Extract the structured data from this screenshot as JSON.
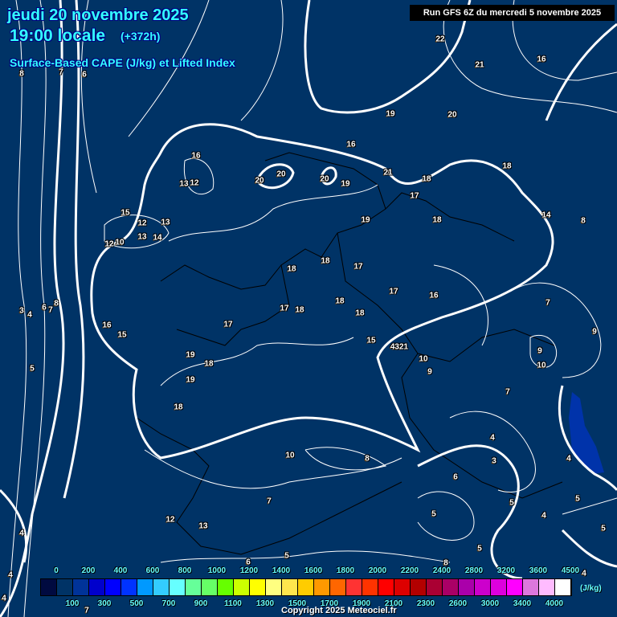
{
  "header": {
    "date": "jeudi 20 novembre 2025",
    "time": "19:00 locale",
    "lead": "(+372h)",
    "parameter": "Surface-Based CAPE (J/kg) et Lifted Index",
    "run": "Run GFS 6Z du mercredi 5 novembre 2025"
  },
  "legend": {
    "unit": "(J/kg)",
    "labels": [
      "0",
      "100",
      "200",
      "300",
      "400",
      "500",
      "600",
      "700",
      "800",
      "900",
      "1000",
      "1100",
      "1200",
      "1300",
      "1400",
      "1500",
      "1600",
      "1700",
      "1800",
      "1900",
      "2000",
      "2100",
      "2200",
      "2300",
      "2400",
      "2600",
      "2800",
      "3000",
      "3200",
      "3400",
      "3600",
      "4000",
      "4500"
    ],
    "colors": [
      "#000a40",
      "#003366",
      "#003399",
      "#0000cc",
      "#0000ff",
      "#0033ff",
      "#0099ff",
      "#33ccff",
      "#66ffff",
      "#66ff99",
      "#66ff66",
      "#66ff00",
      "#ccff00",
      "#ffff00",
      "#ffff80",
      "#ffe64d",
      "#ffcc00",
      "#ff9900",
      "#ff6600",
      "#ff3333",
      "#ff3300",
      "#ff0000",
      "#dd0000",
      "#b30000",
      "#aa0033",
      "#aa0066",
      "#aa00aa",
      "#cc00cc",
      "#dd00dd",
      "#ff00ff",
      "#dd77dd",
      "#ffbbff",
      "#ffffff"
    ]
  },
  "lifted_index_labels": [
    "8",
    "7",
    "6",
    "22",
    "21",
    "16",
    "19",
    "20",
    "16",
    "16",
    "18",
    "21",
    "18",
    "13",
    "12",
    "20",
    "20",
    "20",
    "19",
    "17",
    "15",
    "12",
    "13",
    "14",
    "8",
    "19",
    "18",
    "12",
    "10",
    "13",
    "14",
    "18",
    "18",
    "17",
    "17",
    "16",
    "17",
    "18",
    "18",
    "18",
    "7",
    "3",
    "4",
    "6",
    "7",
    "8",
    "16",
    "15",
    "17",
    "15",
    "4321",
    "9",
    "9",
    "10",
    "10",
    "9",
    "19",
    "18",
    "19",
    "5",
    "7",
    "18",
    "4",
    "3",
    "4",
    "10",
    "8",
    "6",
    "7",
    "5",
    "5",
    "5",
    "4",
    "12",
    "13",
    "5",
    "4",
    "5",
    "6",
    "5",
    "8",
    "4",
    "4",
    "4",
    "7"
  ],
  "copyright": "Copyright 2025 Meteociel.fr",
  "colors": {
    "background": "#003366",
    "title": "#33ffff",
    "cape_shading": "#0033aa"
  }
}
